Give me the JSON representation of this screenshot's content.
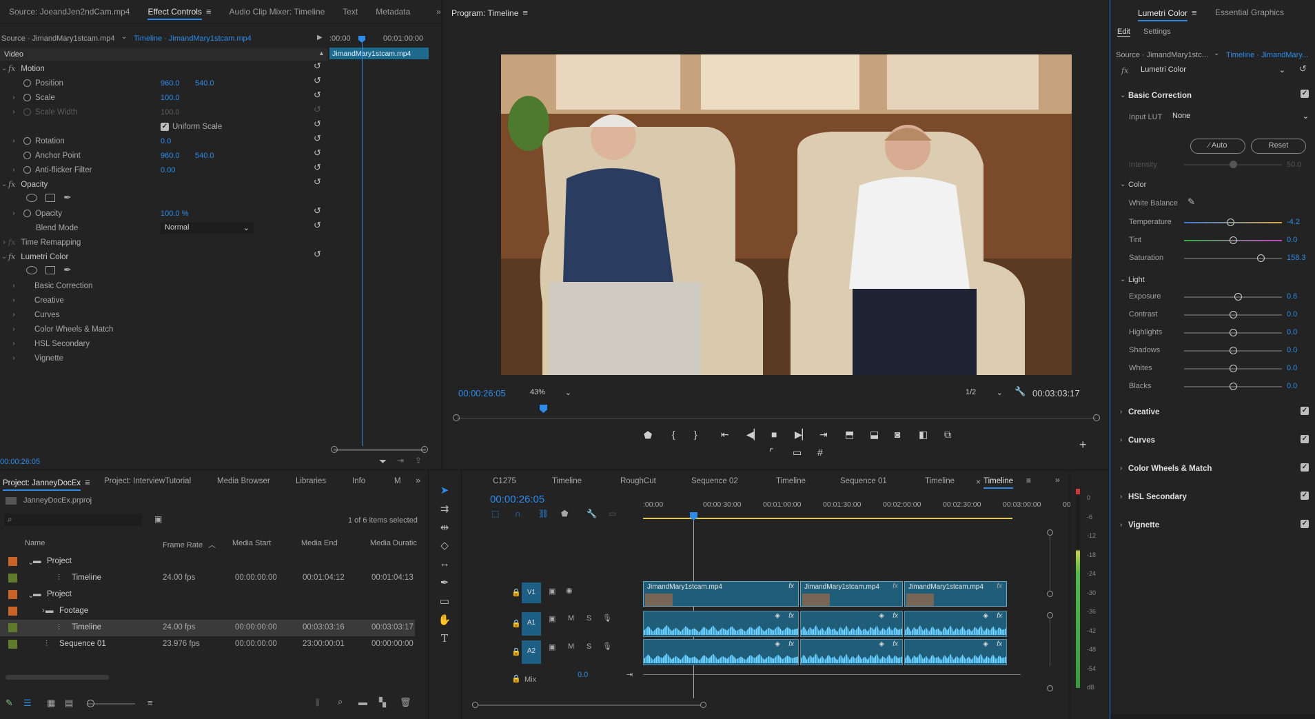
{
  "effect_controls": {
    "tabs": [
      "Source: JoeandJen2ndCam.mp4",
      "Effect Controls",
      "Audio Clip Mixer: Timeline",
      "Text",
      "Metadata"
    ],
    "source": "Source · JimandMary1stcam.mp4",
    "timeline": "Timeline · JimandMary1stcam.mp4",
    "ruler_start": ":00:00",
    "ruler_end": "00:01:00:00",
    "clip_name": "JimandMary1stcam.mp4",
    "video_label": "Video",
    "motion": "Motion",
    "position_label": "Position",
    "position_x": "960.0",
    "position_y": "540.0",
    "scale_label": "Scale",
    "scale_val": "100.0",
    "scale_width_label": "Scale Width",
    "scale_width_val": "100.0",
    "uniform_scale": "Uniform Scale",
    "rotation_label": "Rotation",
    "rotation_val": "0.0",
    "anchor_label": "Anchor Point",
    "anchor_x": "960.0",
    "anchor_y": "540.0",
    "antiflicker_label": "Anti-flicker Filter",
    "antiflicker_val": "0.00",
    "opacity": "Opacity",
    "opacity_label": "Opacity",
    "opacity_val": "100.0 %",
    "blend_label": "Blend Mode",
    "blend_val": "Normal",
    "time_remapping": "Time Remapping",
    "lumetri": "Lumetri Color",
    "lumetri_items": [
      "Basic Correction",
      "Creative",
      "Curves",
      "Color Wheels & Match",
      "HSL Secondary",
      "Vignette"
    ],
    "timecode": "00:00:26:05"
  },
  "program": {
    "title": "Program: Timeline",
    "timecode": "00:00:26:05",
    "zoom": "43%",
    "resolution": "1/2",
    "duration": "00:03:03:17"
  },
  "lumetri_panel": {
    "tabs": [
      "Lumetri Color",
      "Essential Graphics"
    ],
    "subtabs": [
      "Edit",
      "Settings"
    ],
    "source": "Source · JimandMary1stc...",
    "timeline": "Timeline · JimandMary...",
    "effect": "Lumetri Color",
    "basic_correction": "Basic Correction",
    "input_lut_label": "Input LUT",
    "input_lut_val": "None",
    "auto": "Auto",
    "reset": "Reset",
    "intensity_label": "Intensity",
    "intensity_val": "50.0",
    "color_section": "Color",
    "white_balance": "White Balance",
    "light_section": "Light",
    "sliders": [
      {
        "label": "Temperature",
        "value": "-4.2",
        "pos": 0.47
      },
      {
        "label": "Tint",
        "value": "0.0",
        "pos": 0.5
      },
      {
        "label": "Saturation",
        "value": "158.3",
        "pos": 0.78
      },
      {
        "label": "Exposure",
        "value": "0.6",
        "pos": 0.55
      },
      {
        "label": "Contrast",
        "value": "0.0",
        "pos": 0.5
      },
      {
        "label": "Highlights",
        "value": "0.0",
        "pos": 0.5
      },
      {
        "label": "Shadows",
        "value": "0.0",
        "pos": 0.5
      },
      {
        "label": "Whites",
        "value": "0.0",
        "pos": 0.5
      },
      {
        "label": "Blacks",
        "value": "0.0",
        "pos": 0.5
      }
    ],
    "sections": [
      "Creative",
      "Curves",
      "Color Wheels & Match",
      "HSL Secondary",
      "Vignette"
    ]
  },
  "project": {
    "tabs": [
      "Project: JanneyDocEx",
      "Project: InterviewTutorial",
      "Media Browser",
      "Libraries",
      "Info",
      "M"
    ],
    "file": "JanneyDocEx.prproj",
    "selection": "1 of 6 items selected",
    "columns": [
      "Name",
      "Frame Rate",
      "Media Start",
      "Media End",
      "Media Duratic"
    ],
    "rows": [
      {
        "name": "Project",
        "fr": "",
        "start": "",
        "end": "",
        "dur": "",
        "color": "#c86428"
      },
      {
        "name": "Timeline",
        "fr": "24.00 fps",
        "start": "00:00:00:00",
        "end": "00:01:04:12",
        "dur": "00:01:04:13",
        "color": "#5f7a2a"
      },
      {
        "name": "Project",
        "fr": "",
        "start": "",
        "end": "",
        "dur": "",
        "color": "#c86428"
      },
      {
        "name": "Footage",
        "fr": "",
        "start": "",
        "end": "",
        "dur": "",
        "color": "#c86428"
      },
      {
        "name": "Timeline",
        "fr": "24.00 fps",
        "start": "00:00:00:00",
        "end": "00:03:03:16",
        "dur": "00:03:03:17",
        "color": "#5f7a2a"
      },
      {
        "name": "Sequence 01",
        "fr": "23.976 fps",
        "start": "00:00:00:00",
        "end": "23:00:00:01",
        "dur": "00:00:00:00",
        "color": "#5f7a2a"
      }
    ]
  },
  "timeline": {
    "tabs": [
      "C1275",
      "Timeline",
      "RoughCut",
      "Sequence 02",
      "Timeline",
      "Sequence 01",
      "Timeline",
      "Timeline"
    ],
    "timecode": "00:00:26:05",
    "ruler": [
      ":00:00",
      "00:00:30:00",
      "00:01:00:00",
      "00:01:30:00",
      "00:02:00:00",
      "00:02:30:00",
      "00:03:00:00",
      "00"
    ],
    "tracks": [
      "V1",
      "A1",
      "A2"
    ],
    "mix": "Mix",
    "mix_val": "0.0",
    "clips": [
      "JimandMary1stcam.mp4",
      "JimandMary1stcam.mp4",
      "JimandMary1stcam.mp4"
    ]
  },
  "meter": {
    "labels": [
      "0",
      "-6",
      "-12",
      "-18",
      "-24",
      "-30",
      "-36",
      "-42",
      "-48",
      "-54",
      "dB"
    ]
  }
}
